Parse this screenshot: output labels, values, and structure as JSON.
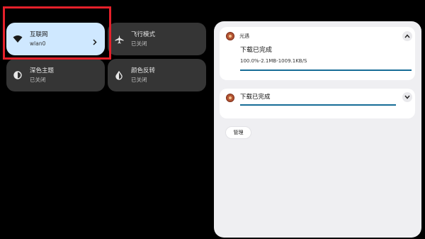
{
  "quick_settings": {
    "internet": {
      "title": "互联网",
      "subtitle": "wlan0",
      "icon": "wifi-icon",
      "chevron": "›"
    },
    "airplane": {
      "title": "飞行模式",
      "subtitle": "已关闭",
      "icon": "airplane-icon"
    },
    "dark_theme": {
      "title": "深色主题",
      "subtitle": "已关闭",
      "icon": "contrast-icon"
    },
    "color_invert": {
      "title": "颜色反转",
      "subtitle": "已关闭",
      "icon": "invert-colors-icon"
    }
  },
  "notifications": {
    "card1": {
      "app_name": "光遇",
      "title": "下载已完成",
      "text": "100.0%-2.1MB-1009.1KB/S",
      "progress": 1.0,
      "expanded": true
    },
    "card2": {
      "title": "下载已完成",
      "progress": 1.0,
      "expanded": false
    },
    "manage_label": "管理"
  },
  "colors": {
    "accent_tile": "#cfe8ff",
    "progress": "#176d97",
    "highlight": "#e5202a"
  }
}
